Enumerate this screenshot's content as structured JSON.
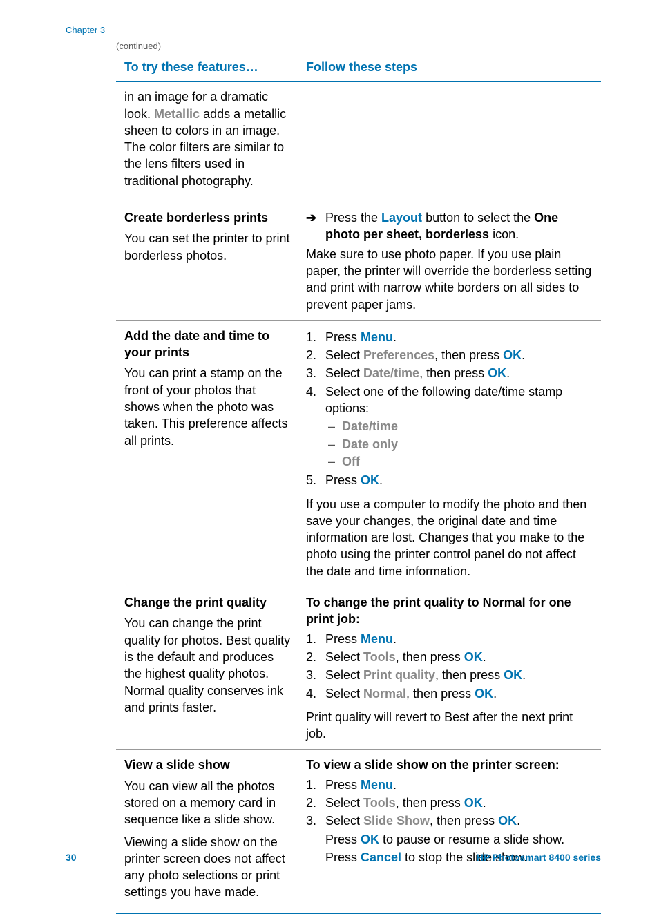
{
  "chapter_label": "Chapter 3",
  "continued": "(continued)",
  "table": {
    "header": {
      "left": "To try these features…",
      "right": "Follow these steps"
    },
    "rows": [
      {
        "left": {
          "desc_html": "in an image for a dramatic look. <span class='hp-gray'>Metallic</span> adds a metallic sheen to colors in an image. The color filters are similar to the lens filters used in traditional photography."
        },
        "right": {
          "html": ""
        }
      },
      {
        "left": {
          "title": "Create borderless prints",
          "desc": "You can set the printer to print borderless photos."
        },
        "right": {
          "arrow_html": "Press the <span class='hp-blue'>Layout</span> button to select the <span class='bold'>One photo per sheet, borderless</span> icon.",
          "para": "Make sure to use photo paper. If you use plain paper, the printer will override the borderless setting and print with narrow white borders on all sides to prevent paper jams."
        }
      },
      {
        "left": {
          "title": "Add the date and time to your prints",
          "desc": "You can print a stamp on the front of your photos that shows when the photo was taken. This preference affects all prints."
        },
        "right": {
          "steps": [
            "Press <span class='hp-blue'>Menu</span>.",
            "Select <span class='hp-gray'>Preferences</span>, then press <span class='hp-blue'>OK</span>.",
            "Select <span class='hp-gray'>Date/time</span>, then press <span class='hp-blue'>OK</span>.",
            "Select one of the following date/time stamp options:"
          ],
          "subopts": [
            "Date/time",
            "Date only",
            "Off"
          ],
          "step5": "Press <span class='hp-blue'>OK</span>.",
          "para": "If you use a computer to modify the photo and then save your changes, the original date and time information are lost. Changes that you make to the photo using the printer control panel do not affect the date and time information."
        }
      },
      {
        "left": {
          "title": "Change the print quality",
          "desc": "You can change the print quality for photos. Best quality is the default and produces the highest quality photos. Normal quality conserves ink and prints faster."
        },
        "right": {
          "steps_title": "To change the print quality to Normal for one print job:",
          "steps": [
            "Press <span class='hp-blue'>Menu</span>.",
            "Select <span class='hp-gray'>Tools</span>, then press <span class='hp-blue'>OK</span>.",
            "Select <span class='hp-gray'>Print quality</span>, then press <span class='hp-blue'>OK</span>.",
            "Select <span class='hp-gray'>Normal</span>, then press <span class='hp-blue'>OK</span>."
          ],
          "para": "Print quality will revert to Best after the next print job."
        }
      },
      {
        "left": {
          "title": "View a slide show",
          "desc": "You can view all the photos stored on a memory card in sequence like a slide show.",
          "desc2": "Viewing a slide show on the printer screen does not affect any photo selections or print settings you have made."
        },
        "right": {
          "steps_title": "To view a slide show on the printer screen:",
          "steps": [
            "Press <span class='hp-blue'>Menu</span>.",
            "Select <span class='hp-gray'>Tools</span>, then press <span class='hp-blue'>OK</span>.",
            "Select <span class='hp-gray'>Slide Show</span>, then press <span class='hp-blue'>OK</span>."
          ],
          "extras": [
            "Press <span class='hp-blue'>OK</span> to pause or resume a slide show.",
            "Press <span class='hp-blue'>Cancel</span> to stop the slide show."
          ]
        }
      }
    ]
  },
  "footer": {
    "page": "30",
    "product": "HP Photosmart 8400 series"
  }
}
